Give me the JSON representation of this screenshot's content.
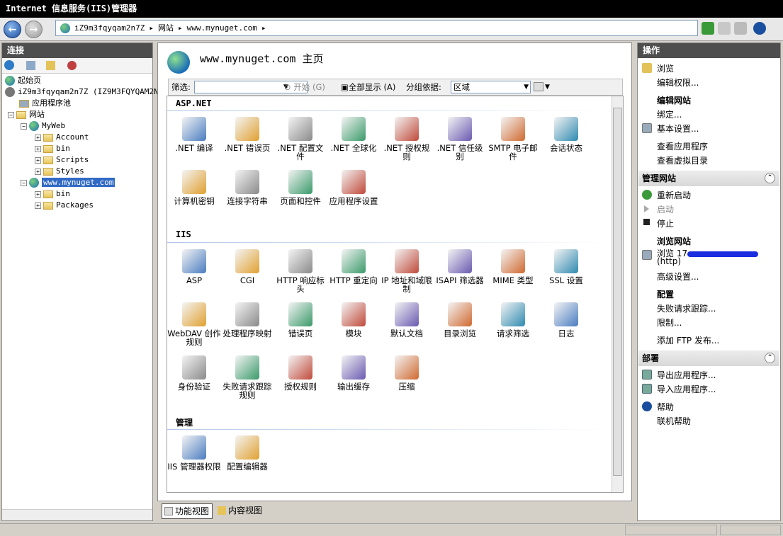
{
  "window": {
    "title": "Internet 信息服务(IIS)管理器"
  },
  "address": {
    "server": "iZ9m3fqyqam2n7Z",
    "sites": "网站",
    "site": "www.mynuget.com"
  },
  "left": {
    "title": "连接",
    "tree": {
      "start": "起始页",
      "server": "iZ9m3fqyqam2n7Z (IZ9M3FQYQAM2N7Z",
      "apppool": "应用程序池",
      "sites": "网站",
      "myweb": "MyWeb",
      "account": "Account",
      "bin1": "bin",
      "scripts": "Scripts",
      "styles": "Styles",
      "mynuget": "www.mynuget.com",
      "bin2": "bin",
      "packages": "Packages"
    }
  },
  "main": {
    "title": "www.mynuget.com 主页",
    "filter": {
      "label": "筛选:",
      "go": "开始 (G)",
      "showall": "全部显示 (A)",
      "groupby": "分组依据:",
      "groupvalue": "区域"
    },
    "sections": {
      "aspnet": "ASP.NET",
      "iis": "IIS",
      "manage": "管理"
    },
    "aspnet_items": [
      ".NET 编译",
      ".NET 错误页",
      ".NET 配置文件",
      ".NET 全球化",
      ".NET 授权规则",
      ".NET 信任级别",
      "SMTP 电子邮件",
      "会话状态",
      "计算机密钥",
      "连接字符串",
      "页面和控件",
      "应用程序设置"
    ],
    "iis_items": [
      "ASP",
      "CGI",
      "HTTP 响应标头",
      "HTTP 重定向",
      "IP 地址和域限制",
      "ISAPI 筛选器",
      "MIME 类型",
      "SSL 设置",
      "WebDAV 创作规则",
      "处理程序映射",
      "错误页",
      "模块",
      "默认文档",
      "目录浏览",
      "请求筛选",
      "日志",
      "身份验证",
      "失败请求跟踪规则",
      "授权规则",
      "输出缓存",
      "压缩"
    ],
    "manage_items": [
      "IIS 管理器权限",
      "配置编辑器"
    ],
    "views": {
      "features": "功能视图",
      "content": "内容视图"
    }
  },
  "right": {
    "title": "操作",
    "actions1": [
      "浏览",
      "编辑权限..."
    ],
    "editsite": "编辑网站",
    "actions2": [
      "绑定...",
      "基本设置...",
      "查看应用程序",
      "查看虚拟目录"
    ],
    "manage": "管理网站",
    "actions3": [
      "重新启动",
      "启动",
      "停止"
    ],
    "browse": "浏览网站",
    "browse_link": "浏览 17",
    "browse_proto": "(http)",
    "advanced": "高级设置...",
    "config": "配置",
    "actions4": [
      "失败请求跟踪...",
      "限制..."
    ],
    "ftp": "添加 FTP 发布...",
    "deploy": "部署",
    "actions5": [
      "导出应用程序...",
      "导入应用程序..."
    ],
    "help": "帮助",
    "onlinehelp": "联机帮助"
  }
}
